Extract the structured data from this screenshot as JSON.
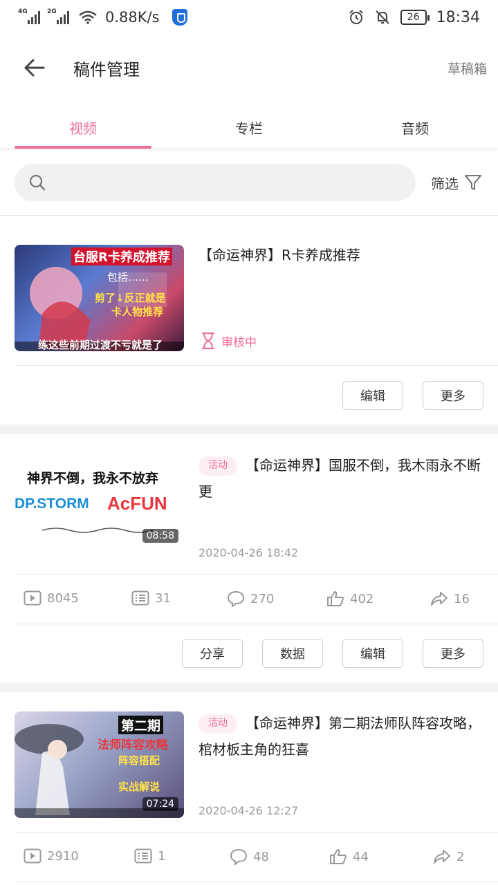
{
  "status_bar": {
    "net1": "4G",
    "net2": "2G",
    "speed": "0.88K/s",
    "battery": "26",
    "time": "18:34"
  },
  "header": {
    "title": "稿件管理",
    "drafts": "草稿箱"
  },
  "tabs": [
    {
      "label": "视频",
      "active": true
    },
    {
      "label": "专栏",
      "active": false
    },
    {
      "label": "音频",
      "active": false
    }
  ],
  "search": {
    "placeholder": "",
    "filter_label": "筛选"
  },
  "colors": {
    "accent": "#f06d96",
    "muted": "#9a9a9a"
  },
  "items": [
    {
      "title": "【命运神界】R卡养成推荐",
      "status": "审核中",
      "thumb_text": [
        "台服R卡养成推荐",
        "包括……",
        "剪了↓反正就是",
        "卡人物推荐",
        "练这些前期过渡不亏就是了"
      ],
      "buttons": [
        "编辑",
        "更多"
      ]
    },
    {
      "badge": "活动",
      "title": "【命运神界】国服不倒，我木雨永不断更",
      "date": "2020-04-26 18:42",
      "duration": "08:58",
      "thumb_text": [
        "神界不倒，我永不放弃",
        "DP.STORM",
        "AcFUN"
      ],
      "stats": {
        "plays": "8045",
        "danmaku": "31",
        "comments": "270",
        "likes": "402",
        "shares": "16"
      },
      "buttons": [
        "分享",
        "数据",
        "编辑",
        "更多"
      ]
    },
    {
      "badge": "活动",
      "title": "【命运神界】第二期法师队阵容攻略，棺材板主角的狂喜",
      "date": "2020-04-26 12:27",
      "duration": "07:24",
      "thumb_text": [
        "第二期",
        "法师阵容攻略",
        "阵容搭配",
        "实战解说"
      ],
      "stats": {
        "plays": "2910",
        "danmaku": "1",
        "comments": "48",
        "likes": "44",
        "shares": "2"
      }
    }
  ]
}
